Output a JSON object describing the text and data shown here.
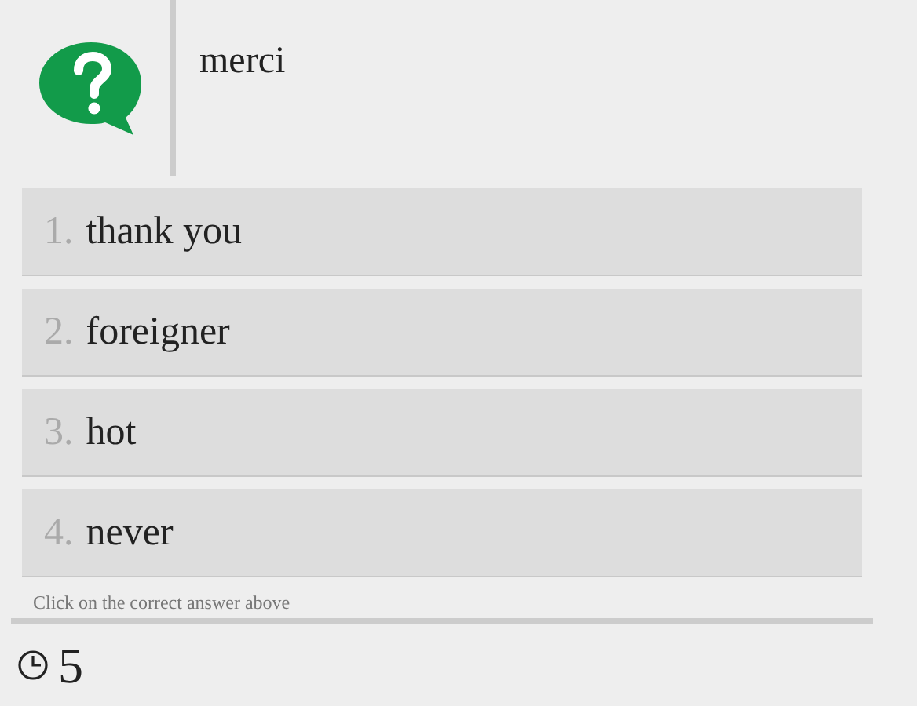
{
  "prompt": "merci",
  "answers": [
    {
      "number": "1.",
      "text": "thank you"
    },
    {
      "number": "2.",
      "text": "foreigner"
    },
    {
      "number": "3.",
      "text": "hot"
    },
    {
      "number": "4.",
      "text": "never"
    }
  ],
  "instruction": "Click on the correct answer above",
  "timer": "5"
}
